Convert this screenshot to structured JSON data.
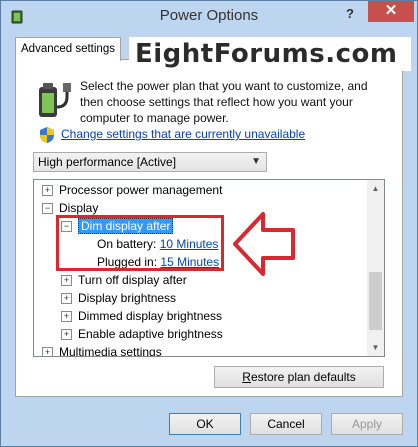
{
  "window": {
    "title": "Power Options",
    "help_label": "?",
    "close_label": "✕"
  },
  "tab": {
    "label": "Advanced settings"
  },
  "watermark": {
    "text": "EightForums.com"
  },
  "intro": {
    "description": "Select the power plan that you want to customize, and then choose settings that reflect how you want your computer to manage power.",
    "change_link": "Change settings that are currently unavailable"
  },
  "plan_select": {
    "value": "High performance [Active]"
  },
  "tree": {
    "processor": "Processor power management",
    "display": "Display",
    "dim_display": "Dim display after",
    "on_battery_label": "On battery:",
    "on_battery_value": "10 Minutes",
    "plugged_in_label": "Plugged in:",
    "plugged_in_value": "15 Minutes",
    "turn_off_display": "Turn off display after",
    "display_brightness": "Display brightness",
    "dimmed_brightness": "Dimmed display brightness",
    "adaptive_brightness": "Enable adaptive brightness",
    "multimedia": "Multimedia settings",
    "expand_plus": "+",
    "expand_minus": "−"
  },
  "buttons": {
    "restore_prefix": "R",
    "restore_rest": "estore plan defaults",
    "ok": "OK",
    "cancel": "Cancel",
    "apply": "Apply"
  },
  "colors": {
    "highlight": "#d9282f",
    "selection": "#3399ff",
    "link": "#0645ad"
  }
}
